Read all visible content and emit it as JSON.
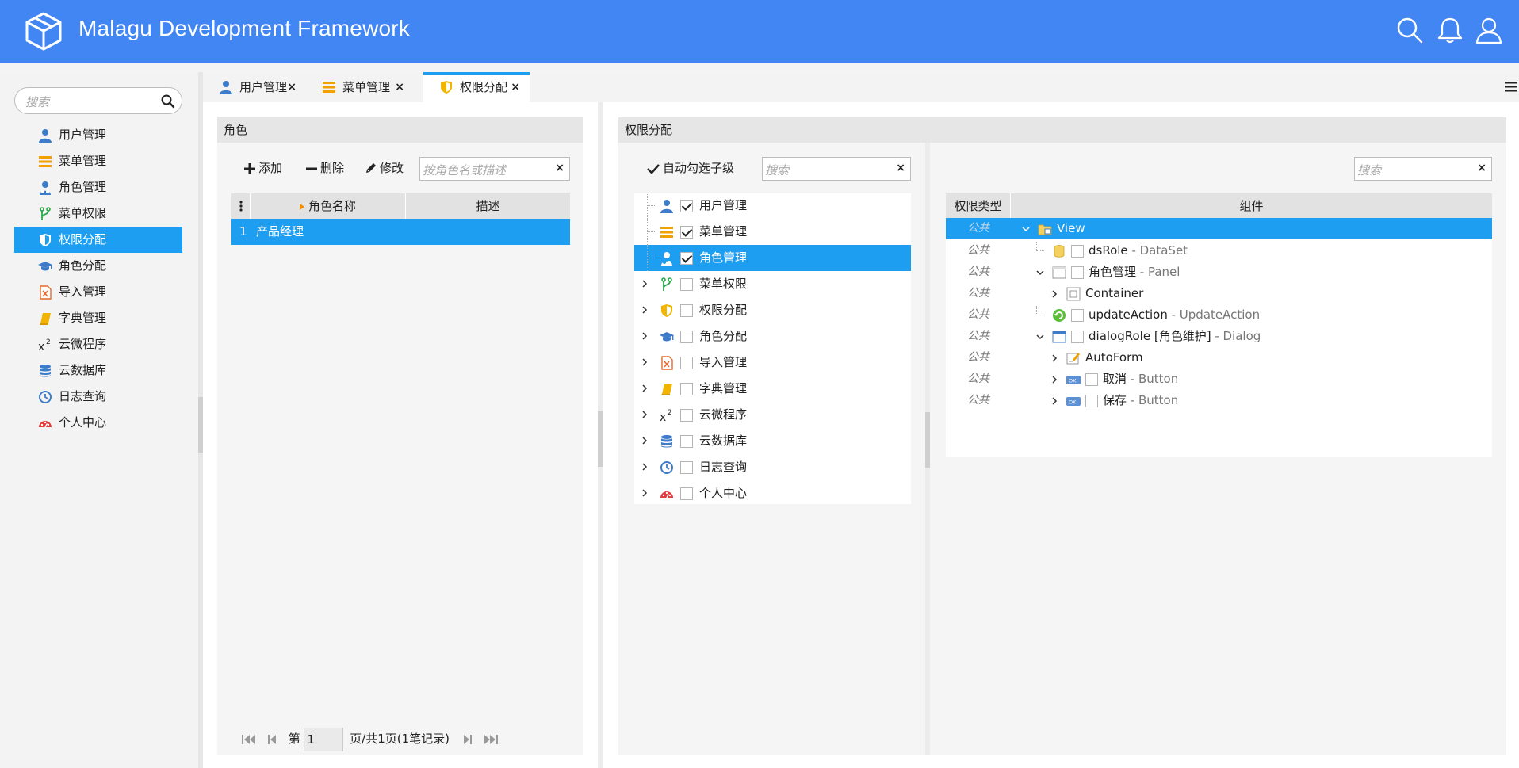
{
  "app": {
    "title": "Malagu Development Framework"
  },
  "colors": {
    "header": "#4286f4",
    "accent": "#1e9ef0"
  },
  "sidebar": {
    "search_placeholder": "搜索",
    "items": [
      {
        "label": "用户管理",
        "icon": "user-icon"
      },
      {
        "label": "菜单管理",
        "icon": "menu-icon"
      },
      {
        "label": "角色管理",
        "icon": "role-icon"
      },
      {
        "label": "菜单权限",
        "icon": "branch-icon"
      },
      {
        "label": "权限分配",
        "icon": "shield-icon",
        "active": true
      },
      {
        "label": "角色分配",
        "icon": "graduation-cap-icon"
      },
      {
        "label": "导入管理",
        "icon": "excel-file-icon"
      },
      {
        "label": "字典管理",
        "icon": "book-icon"
      },
      {
        "label": "云微程序",
        "icon": "superscript-icon"
      },
      {
        "label": "云数据库",
        "icon": "database-icon"
      },
      {
        "label": "日志查询",
        "icon": "clock-icon"
      },
      {
        "label": "个人中心",
        "icon": "dashboard-icon"
      }
    ]
  },
  "tabs": [
    {
      "label": "用户管理",
      "close": "×"
    },
    {
      "label": "菜单管理",
      "close": "×"
    },
    {
      "label": "权限分配",
      "close": "×",
      "active": true
    }
  ],
  "role_panel": {
    "title": "角色",
    "add_label": "添加",
    "delete_label": "删除",
    "edit_label": "修改",
    "filter_placeholder": "按角色名或描述",
    "clear": "×",
    "columns": {
      "name": "角色名称",
      "desc": "描述"
    },
    "rows": [
      {
        "index": "1",
        "name": "产品经理",
        "desc": ""
      }
    ],
    "pager": {
      "prefix": "第",
      "page": "1",
      "suffix": "页/共1页(1笔记录)"
    }
  },
  "perm_panel": {
    "title": "权限分配",
    "auto_check_label": "自动勾选子级",
    "search_placeholder": "搜索",
    "clear": "×",
    "tree": [
      {
        "label": "用户管理",
        "checked": true,
        "expandable": false,
        "icon": "user-icon"
      },
      {
        "label": "菜单管理",
        "checked": true,
        "expandable": false,
        "icon": "menu-icon"
      },
      {
        "label": "角色管理",
        "checked": true,
        "expandable": false,
        "icon": "role-icon",
        "selected": true
      },
      {
        "label": "菜单权限",
        "checked": false,
        "expandable": true,
        "icon": "branch-icon"
      },
      {
        "label": "权限分配",
        "checked": false,
        "expandable": true,
        "icon": "shield-icon"
      },
      {
        "label": "角色分配",
        "checked": false,
        "expandable": true,
        "icon": "graduation-cap-icon"
      },
      {
        "label": "导入管理",
        "checked": false,
        "expandable": true,
        "icon": "excel-file-icon"
      },
      {
        "label": "字典管理",
        "checked": false,
        "expandable": true,
        "icon": "book-icon"
      },
      {
        "label": "云微程序",
        "checked": false,
        "expandable": true,
        "icon": "superscript-icon"
      },
      {
        "label": "云数据库",
        "checked": false,
        "expandable": true,
        "icon": "database-icon"
      },
      {
        "label": "日志查询",
        "checked": false,
        "expandable": true,
        "icon": "clock-icon"
      },
      {
        "label": "个人中心",
        "checked": false,
        "expandable": true,
        "icon": "dashboard-icon"
      }
    ]
  },
  "component_panel": {
    "search_placeholder": "搜索",
    "clear": "×",
    "columns": {
      "type": "权限类型",
      "component": "组件"
    },
    "rows": [
      {
        "ptype": "公共",
        "name": "View",
        "type": "",
        "depth": 0,
        "arrow": "down",
        "checkbox": false,
        "icon": "view-folder-icon",
        "selected": true
      },
      {
        "ptype": "公共",
        "name": "dsRole",
        "type": " - DataSet",
        "depth": 1,
        "arrow": "none",
        "checkbox": true,
        "icon": "dataset-icon"
      },
      {
        "ptype": "公共",
        "name": "角色管理",
        "type": " - Panel",
        "depth": 1,
        "arrow": "down",
        "checkbox": true,
        "icon": "panel-icon"
      },
      {
        "ptype": "公共",
        "name": "Container",
        "type": "",
        "depth": 2,
        "arrow": "right",
        "checkbox": false,
        "icon": "container-icon"
      },
      {
        "ptype": "公共",
        "name": "updateAction",
        "type": " - UpdateAction",
        "depth": 1,
        "arrow": "none",
        "checkbox": true,
        "icon": "update-action-icon"
      },
      {
        "ptype": "公共",
        "name": "dialogRole [角色维护]",
        "type": " - Dialog",
        "depth": 1,
        "arrow": "down",
        "checkbox": true,
        "icon": "dialog-icon"
      },
      {
        "ptype": "公共",
        "name": "AutoForm",
        "type": "",
        "depth": 2,
        "arrow": "right",
        "checkbox": false,
        "icon": "autoform-icon"
      },
      {
        "ptype": "公共",
        "name": "取消",
        "type": " - Button",
        "depth": 2,
        "arrow": "right",
        "checkbox": true,
        "icon": "ok-button-icon"
      },
      {
        "ptype": "公共",
        "name": "保存",
        "type": " - Button",
        "depth": 2,
        "arrow": "right",
        "checkbox": true,
        "icon": "ok-button-icon"
      }
    ]
  }
}
